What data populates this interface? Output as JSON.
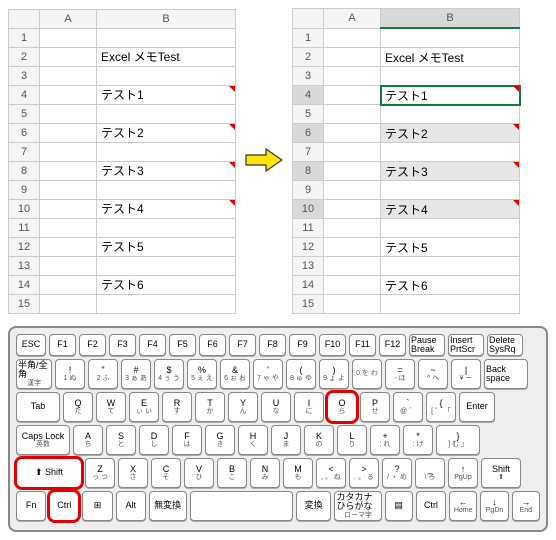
{
  "sheet_left": {
    "col_headers": [
      "A",
      "B"
    ],
    "rows": [
      {
        "n": "1",
        "a": "",
        "b": ""
      },
      {
        "n": "2",
        "a": "",
        "b": "Excel メモTest"
      },
      {
        "n": "3",
        "a": "",
        "b": ""
      },
      {
        "n": "4",
        "a": "",
        "b": "テスト1",
        "c": true
      },
      {
        "n": "5",
        "a": "",
        "b": ""
      },
      {
        "n": "6",
        "a": "",
        "b": "テスト2",
        "c": true
      },
      {
        "n": "7",
        "a": "",
        "b": ""
      },
      {
        "n": "8",
        "a": "",
        "b": "テスト3",
        "c": true
      },
      {
        "n": "9",
        "a": "",
        "b": ""
      },
      {
        "n": "10",
        "a": "",
        "b": "テスト4",
        "c": true
      },
      {
        "n": "11",
        "a": "",
        "b": ""
      },
      {
        "n": "12",
        "a": "",
        "b": "テスト5"
      },
      {
        "n": "13",
        "a": "",
        "b": ""
      },
      {
        "n": "14",
        "a": "",
        "b": "テスト6"
      },
      {
        "n": "15",
        "a": "",
        "b": ""
      }
    ]
  },
  "sheet_right": {
    "col_headers": [
      "A",
      "B"
    ],
    "rows": [
      {
        "n": "1",
        "a": "",
        "b": ""
      },
      {
        "n": "2",
        "a": "",
        "b": "Excel メモTest"
      },
      {
        "n": "3",
        "a": "",
        "b": ""
      },
      {
        "n": "4",
        "a": "",
        "b": "テスト1",
        "c": true,
        "active": true
      },
      {
        "n": "5",
        "a": "",
        "b": ""
      },
      {
        "n": "6",
        "a": "",
        "b": "テスト2",
        "c": true,
        "sel": true
      },
      {
        "n": "7",
        "a": "",
        "b": ""
      },
      {
        "n": "8",
        "a": "",
        "b": "テスト3",
        "c": true,
        "sel": true
      },
      {
        "n": "9",
        "a": "",
        "b": ""
      },
      {
        "n": "10",
        "a": "",
        "b": "テスト4",
        "c": true,
        "sel": true
      },
      {
        "n": "11",
        "a": "",
        "b": ""
      },
      {
        "n": "12",
        "a": "",
        "b": "テスト5"
      },
      {
        "n": "13",
        "a": "",
        "b": ""
      },
      {
        "n": "14",
        "a": "",
        "b": "テスト6"
      },
      {
        "n": "15",
        "a": "",
        "b": ""
      }
    ]
  },
  "kb": {
    "r1": [
      "ESC",
      "F1",
      "F2",
      "F3",
      "F4",
      "F5",
      "F6",
      "F7",
      "F8",
      "F9",
      "F10",
      "F11",
      "F12",
      "Pause Break",
      "Insert PrtScr",
      "Delete SysRq"
    ],
    "r2": [
      {
        "m": "半角/全角",
        "s": "漢字"
      },
      {
        "m": "!",
        "s": "1 ぬ"
      },
      {
        "m": "\"",
        "s": "2 ふ"
      },
      {
        "m": "#",
        "s": "3 ぁ あ"
      },
      {
        "m": "$",
        "s": "4 ぅ う"
      },
      {
        "m": "%",
        "s": "5 ぇ え"
      },
      {
        "m": "&",
        "s": "6 ぉ お"
      },
      {
        "m": "'",
        "s": "7 ゃ や"
      },
      {
        "m": "(",
        "s": "8 ゅ ゆ"
      },
      {
        "m": ")",
        "s": "9 ょ よ"
      },
      {
        "m": "",
        "s": "0 を わ"
      },
      {
        "m": "=",
        "s": "- ほ"
      },
      {
        "m": "~",
        "s": "^ へ"
      },
      {
        "m": "|",
        "s": "¥ ー"
      },
      {
        "m": "Back space",
        "s": ""
      }
    ],
    "r3": [
      {
        "m": "Tab",
        "s": ""
      },
      {
        "m": "Q",
        "s": "た"
      },
      {
        "m": "W",
        "s": "て"
      },
      {
        "m": "E",
        "s": "ぃ い"
      },
      {
        "m": "R",
        "s": "す"
      },
      {
        "m": "T",
        "s": "か"
      },
      {
        "m": "Y",
        "s": "ん"
      },
      {
        "m": "U",
        "s": "な"
      },
      {
        "m": "I",
        "s": "に"
      },
      {
        "m": "O",
        "s": "ら",
        "hl": true
      },
      {
        "m": "P",
        "s": "せ"
      },
      {
        "m": "`",
        "s": "@ ゛"
      },
      {
        "m": "{",
        "s": "[ ゜ 「"
      },
      {
        "m": "Enter",
        "s": ""
      }
    ],
    "r4": [
      {
        "m": "Caps Lock",
        "s": "英数"
      },
      {
        "m": "A",
        "s": "ち"
      },
      {
        "m": "S",
        "s": "と"
      },
      {
        "m": "D",
        "s": "し"
      },
      {
        "m": "F",
        "s": "は"
      },
      {
        "m": "G",
        "s": "き"
      },
      {
        "m": "H",
        "s": "く"
      },
      {
        "m": "J",
        "s": "ま"
      },
      {
        "m": "K",
        "s": "の"
      },
      {
        "m": "L",
        "s": "り"
      },
      {
        "m": "+",
        "s": "; れ"
      },
      {
        "m": "*",
        "s": ": け"
      },
      {
        "m": "}",
        "s": "] む 」"
      }
    ],
    "r5": [
      {
        "m": "⬆ Shift",
        "s": "",
        "hl": true
      },
      {
        "m": "Z",
        "s": "っ つ"
      },
      {
        "m": "X",
        "s": "さ"
      },
      {
        "m": "C",
        "s": "そ"
      },
      {
        "m": "V",
        "s": "ひ"
      },
      {
        "m": "B",
        "s": "こ"
      },
      {
        "m": "N",
        "s": "み"
      },
      {
        "m": "M",
        "s": "も"
      },
      {
        "m": "<",
        "s": ", 、 ね"
      },
      {
        "m": ">",
        "s": ". 。 る"
      },
      {
        "m": "?",
        "s": "/ ・ め"
      },
      {
        "m": "_",
        "s": "\\ ろ"
      },
      {
        "m": "↑",
        "s": "PgUp"
      },
      {
        "m": "Shift",
        "s": "⬆"
      }
    ],
    "r6": [
      {
        "m": "Fn",
        "s": ""
      },
      {
        "m": "Ctrl",
        "s": "",
        "hl": true
      },
      {
        "m": "⊞",
        "s": ""
      },
      {
        "m": "Alt",
        "s": ""
      },
      {
        "m": "無変換",
        "s": ""
      },
      {
        "m": "",
        "s": ""
      },
      {
        "m": "変換",
        "s": ""
      },
      {
        "m": "カタカナ ひらがな",
        "s": "ローマ字"
      },
      {
        "m": "▤",
        "s": ""
      },
      {
        "m": "Ctrl",
        "s": ""
      },
      {
        "m": "←",
        "s": "Home"
      },
      {
        "m": "↓",
        "s": "PgDn"
      },
      {
        "m": "→",
        "s": "End"
      }
    ]
  }
}
